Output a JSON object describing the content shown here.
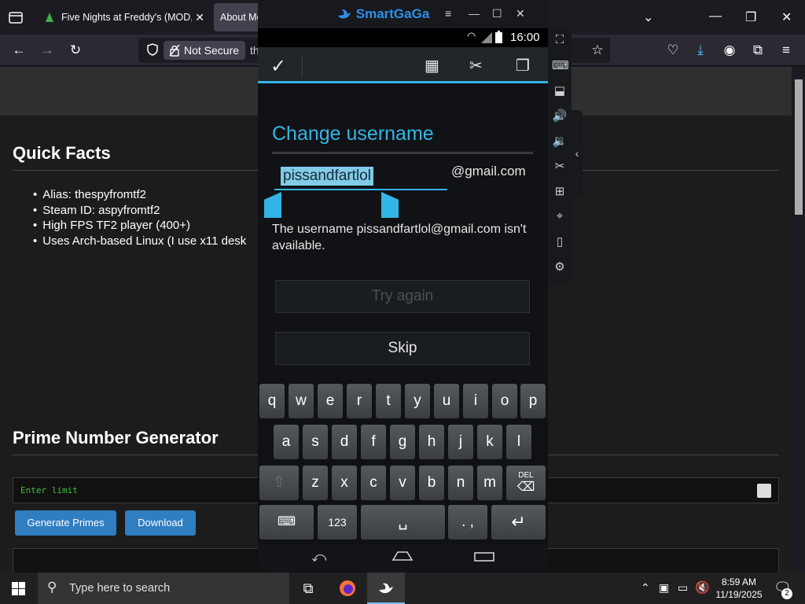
{
  "browser": {
    "tabs": [
      {
        "title": "Five Nights at Freddy's (MOD, U",
        "active": false
      },
      {
        "title": "About Me",
        "active": true
      }
    ],
    "security_label": "Not Secure",
    "url_partial": "th"
  },
  "page": {
    "quick_facts": {
      "title": "Quick Facts",
      "items": [
        "Alias: thespyfromtf2",
        "Steam ID: aspyfromtf2",
        "High FPS TF2 player (400+)",
        "Uses Arch-based Linux (I use x11 desk"
      ]
    },
    "prime_generator": {
      "title": "Prime Number Generator",
      "input_placeholder": "Enter limit",
      "generate_label": "Generate Primes",
      "download_label": "Download"
    }
  },
  "emulator": {
    "app_name": "SmartGaGa",
    "status_time": "16:00",
    "dialog": {
      "title": "Change username",
      "username_value": "pissandfartlol",
      "domain": "@gmail.com",
      "message": "The username pissandfartlol@gmail.com isn't available.",
      "try_again_label": "Try again",
      "skip_label": "Skip"
    },
    "keyboard": {
      "row1": [
        "q",
        "w",
        "e",
        "r",
        "t",
        "y",
        "u",
        "i",
        "o",
        "p"
      ],
      "row2": [
        "a",
        "s",
        "d",
        "f",
        "g",
        "h",
        "j",
        "k",
        "l"
      ],
      "row3": [
        "z",
        "x",
        "c",
        "v",
        "b",
        "n",
        "m"
      ],
      "del_label": "DEL",
      "numbers_label": "123",
      "punct_label": ". ,"
    }
  },
  "taskbar": {
    "search_placeholder": "Type here to search",
    "time": "8:59 AM",
    "date": "11/19/2025",
    "notification_count": "2"
  },
  "colors": {
    "accent_android": "#33b5e5",
    "button_blue": "#2f7ec1",
    "emulator_brand": "#2f8fe8"
  }
}
